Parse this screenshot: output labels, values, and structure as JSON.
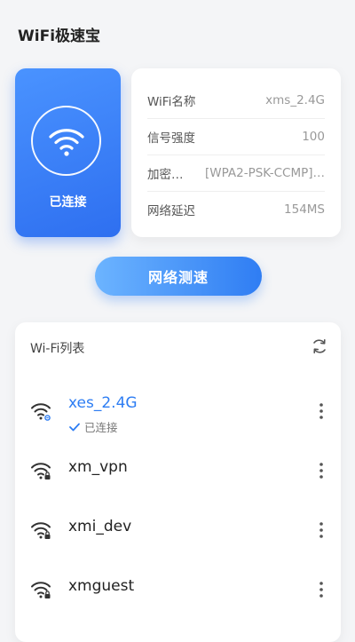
{
  "header": {
    "title": "WiFi极速宝"
  },
  "status": {
    "label": "已连接"
  },
  "info": [
    {
      "key": "WiFi名称",
      "value": "xms_2.4G"
    },
    {
      "key": "信号强度",
      "value": "100"
    },
    {
      "key": "加密…",
      "value": "[WPA2-PSK-CCMP]…"
    },
    {
      "key": "网络延迟",
      "value": "154MS"
    }
  ],
  "speed_test": {
    "label": "网络测速"
  },
  "wifi_list": {
    "title": "Wi-Fi列表",
    "items": [
      {
        "name": "xes_2.4G",
        "status": "已连接",
        "connected": true
      },
      {
        "name": "xm_vpn",
        "locked": true
      },
      {
        "name": "xmi_dev",
        "locked": true
      },
      {
        "name": "xmguest",
        "locked": true
      }
    ]
  },
  "colors": {
    "accent": "#2d7df3",
    "card_start": "#4a93ff",
    "card_end": "#2e6ff0"
  }
}
